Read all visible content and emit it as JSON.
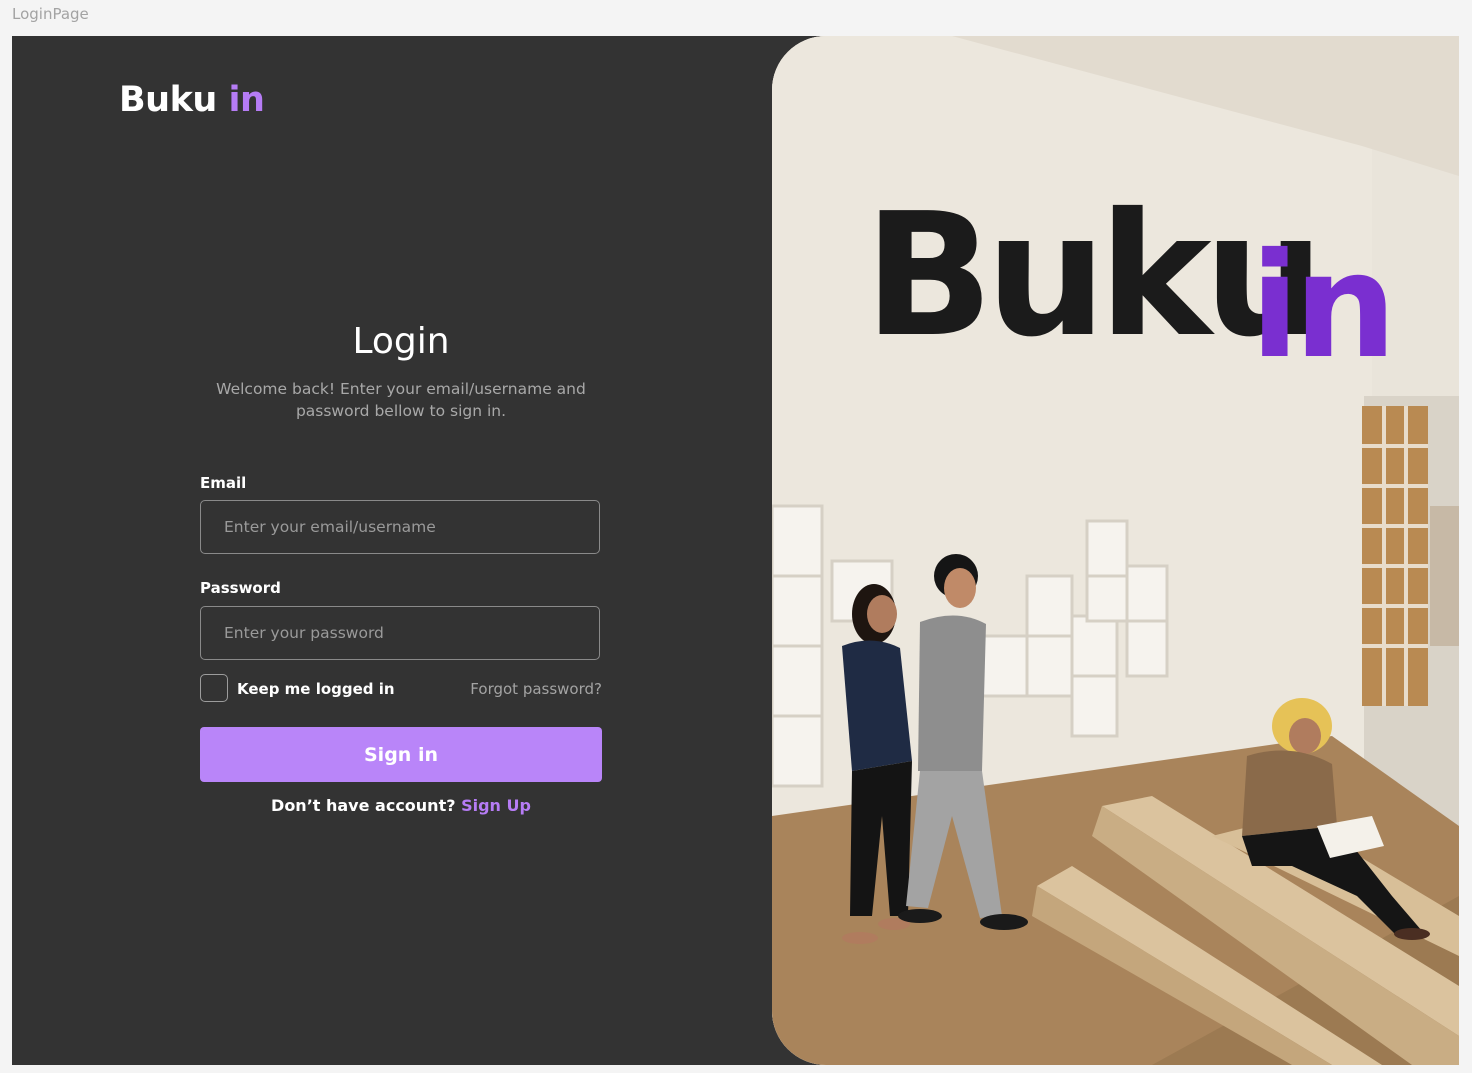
{
  "window": {
    "frame_label": "LoginPage"
  },
  "brand": {
    "name": "Buku",
    "accent": "in"
  },
  "login": {
    "title": "Login",
    "subtitle": "Welcome back!  Enter your email/username and password bellow to sign in.",
    "email_label": "Email",
    "email_placeholder": "Enter your email/username",
    "email_value": "",
    "password_label": "Password",
    "password_placeholder": "Enter your password",
    "password_value": "",
    "keep_logged_in_label": "Keep me logged in",
    "keep_logged_in_checked": false,
    "forgot_password_label": "Forgot password?",
    "signin_label": "Sign in",
    "no_account_text": "Don’t have account?",
    "signup_label": "Sign Up"
  },
  "photo": {
    "wall_sign_main": "Buku",
    "wall_sign_accent": "in"
  },
  "colors": {
    "background_panel": "#333333",
    "accent": "#b67cf5",
    "button": "#b985f9",
    "page_bg": "#f4f4f4"
  }
}
